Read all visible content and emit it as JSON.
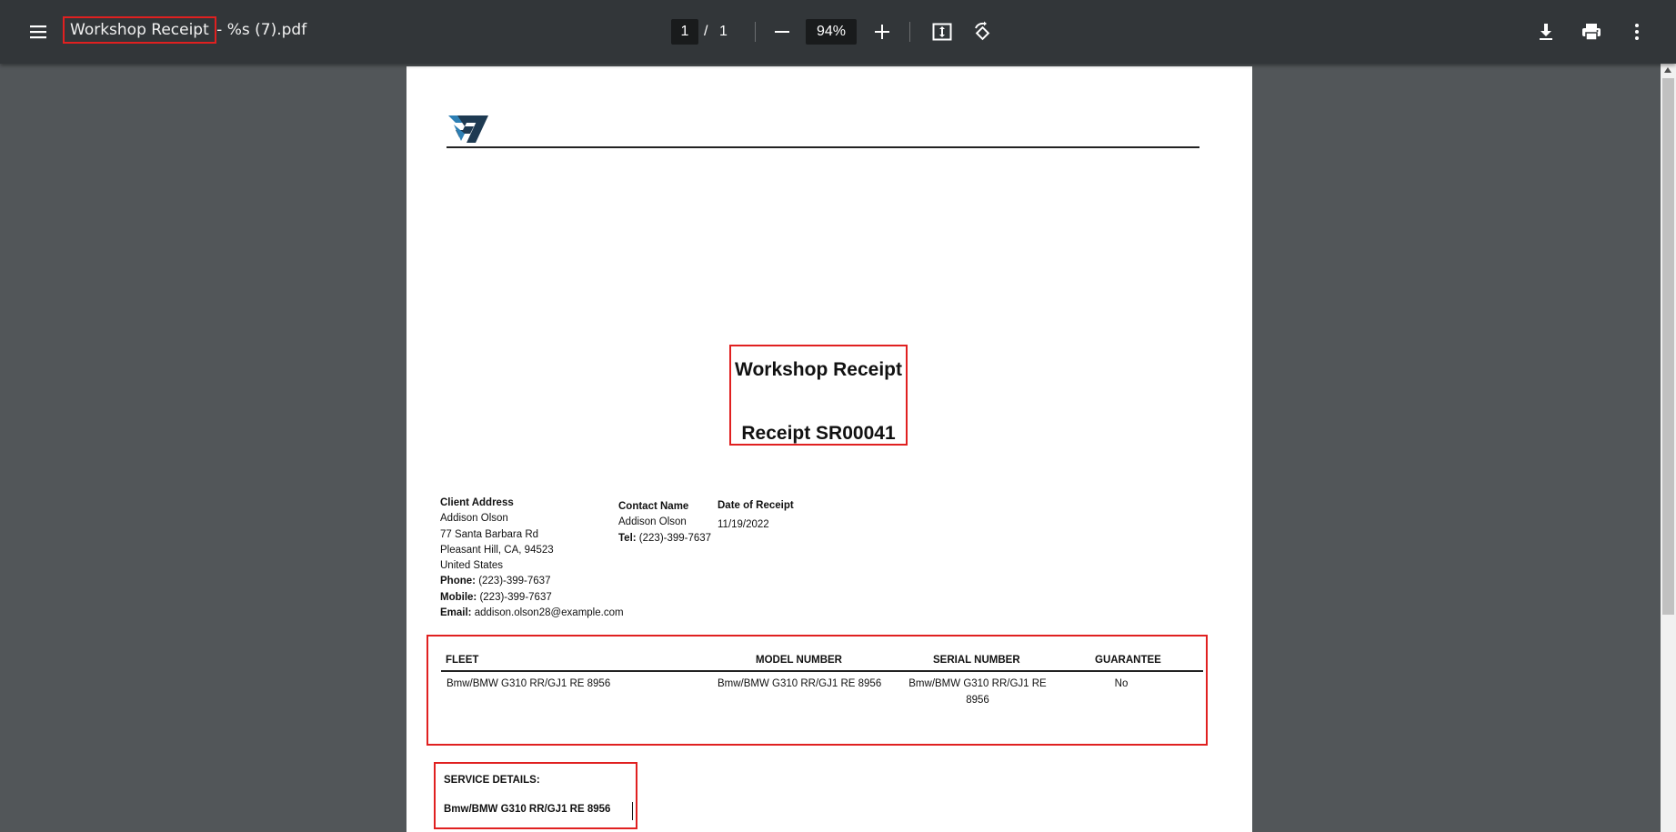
{
  "toolbar": {
    "title_highlight": "Workshop Receipt",
    "title_rest": " - %s (7).pdf",
    "page_current": "1",
    "page_sep": "/",
    "page_total": "1",
    "zoom": "94%"
  },
  "document": {
    "title": "Workshop Receipt",
    "receipt_number": "Receipt SR00041",
    "client": {
      "heading": "Client Address",
      "name": "Addison Olson",
      "street": "77 Santa Barbara Rd",
      "city": "Pleasant Hill, CA, 94523",
      "country": "United States",
      "phone_label": "Phone:",
      "phone": "(223)-399-7637",
      "mobile_label": "Mobile:",
      "mobile": "(223)-399-7637",
      "email_label": "Email:",
      "email": "addison.olson28@example.com"
    },
    "contact": {
      "heading": "Contact Name",
      "name": "Addison Olson",
      "tel_label": "Tel:",
      "tel": "(223)-399-7637"
    },
    "receipt_date": {
      "heading": "Date of Receipt",
      "value": "11/19/2022"
    },
    "table": {
      "headers": [
        "FLEET",
        "MODEL NUMBER",
        "SERIAL NUMBER",
        "GUARANTEE"
      ],
      "rows": [
        [
          "Bmw/BMW G310 RR/GJ1 RE 8956",
          "Bmw/BMW G310 RR/GJ1 RE 8956",
          "Bmw/BMW G310 RR/GJ1 RE 8956",
          "No"
        ]
      ]
    },
    "service": {
      "heading": "SERVICE DETAILS:",
      "value": "Bmw/BMW G310 RR/GJ1 RE 8956"
    }
  }
}
